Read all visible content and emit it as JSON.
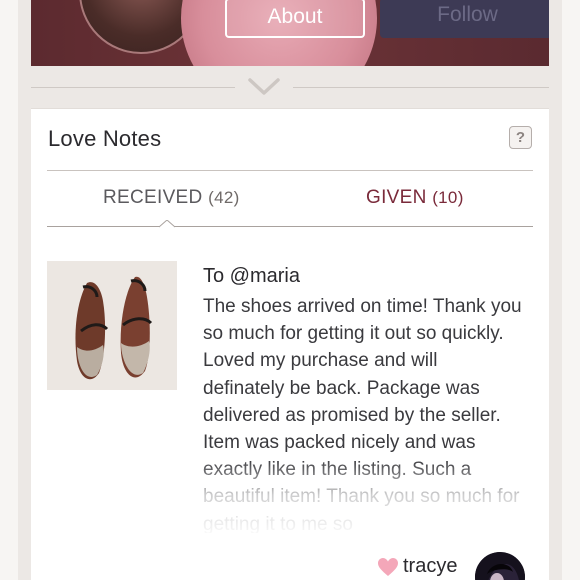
{
  "header": {
    "about_label": "About",
    "follow_label": "Follow"
  },
  "love_notes": {
    "title": "Love Notes",
    "help_label": "?",
    "tabs": [
      {
        "label": "RECEIVED",
        "count": "(42)",
        "active": true
      },
      {
        "label": "GIVEN",
        "count": "(10)",
        "active": false
      }
    ],
    "note": {
      "recipient": "To @maria",
      "body": "The shoes arrived on time! Thank you so much for getting it out so quickly. Loved my purchase and will definately be back. Package was delivered as promised by the seller. Item was packed nicely and was exactly like in the listing. Such a beautiful item! Thank you so much for getting it to me so",
      "sender": "tracye"
    }
  },
  "colors": {
    "banner": "#5c2a2f",
    "given_tab": "#7a2a3a",
    "heart": "#f4a7b9"
  },
  "icons": {
    "chevron": "chevron-down-icon",
    "help": "help-icon",
    "heart": "heart-icon"
  }
}
